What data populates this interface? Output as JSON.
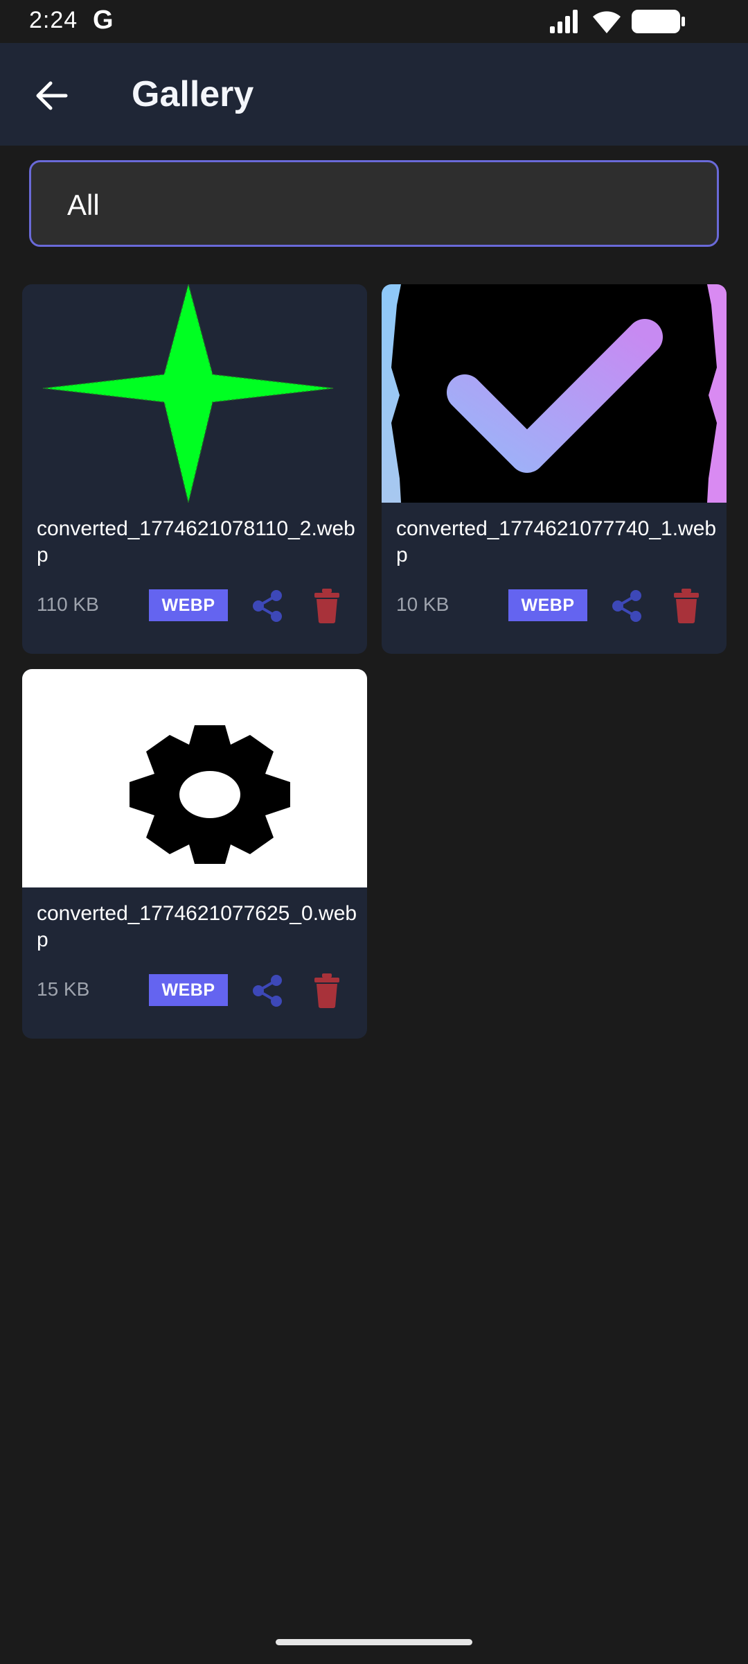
{
  "status_bar": {
    "time": "2:24",
    "google_label": "G",
    "icons": [
      "signal-icon",
      "wifi-icon",
      "battery-icon"
    ]
  },
  "header": {
    "title": "Gallery",
    "back_icon": "arrow-left-icon"
  },
  "filter": {
    "selected": "All",
    "accent": "#6a6ad8"
  },
  "items": [
    {
      "filename": "converted_1774621078110_2.webp",
      "size": "110 KB",
      "format": "WEBP",
      "thumbnail": "green-four-point-star"
    },
    {
      "filename": "converted_1774621077740_1.webp",
      "size": "10 KB",
      "format": "WEBP",
      "thumbnail": "gradient-checkmark"
    },
    {
      "filename": "converted_1774621077625_0.webp",
      "size": "15 KB",
      "format": "WEBP",
      "thumbnail": "black-gear"
    }
  ],
  "colors": {
    "badge": "#6464f0",
    "share": "#3d48b8",
    "delete": "#a8323a",
    "card": "#1f2636",
    "background": "#1b1b1b"
  }
}
